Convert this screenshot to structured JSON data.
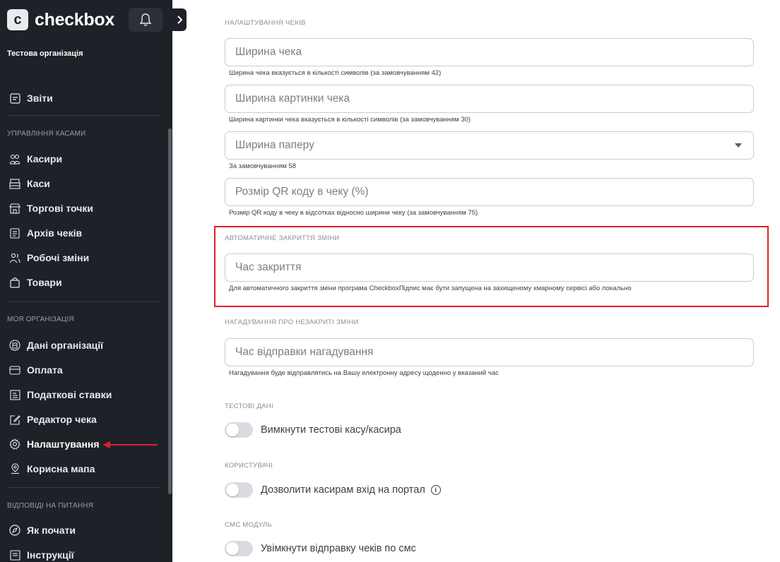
{
  "sidebar": {
    "logo_letter": "c",
    "logo_text": "checkbox",
    "org_name": "Тестова організація",
    "reports": "Звіти",
    "sections": {
      "cash": "УПРАВЛІННЯ КАСАМИ",
      "org": "МОЯ ОРГАНІЗАЦІЯ",
      "faq": "ВІДПОВІДІ НА ПИТАННЯ"
    },
    "items": {
      "cashiers": "Касири",
      "registers": "Каси",
      "points": "Торгові точки",
      "archive": "Архів чеків",
      "shifts": "Робочі зміни",
      "goods": "Товари",
      "org_data": "Дані організації",
      "payment": "Оплата",
      "tax": "Податкові ставки",
      "editor": "Редактор чека",
      "settings": "Налаштування",
      "map": "Корисна мапа",
      "start": "Як почати",
      "instructions": "Інструкції"
    },
    "active_item": "settings"
  },
  "main": {
    "receipt_settings": {
      "title": "НАЛАШТУВАННЯ ЧЕКІВ",
      "width_placeholder": "Ширина чека",
      "width_hint": "Ширина чека вказується в кількості символів (за замовчуванням 42)",
      "image_width_placeholder": "Ширина картинки чека",
      "image_width_hint": "Ширина картинки чека вказується в кількості символів (за замовчуванням 30)",
      "paper_width_placeholder": "Ширина паперу",
      "paper_width_hint": "За замовчуванням 58",
      "qr_placeholder": "Розмір QR коду в чеку (%)",
      "qr_hint": "Розмір QR коду в чеку в відсотках відносно ширини чеку (за замовчуванням 75)"
    },
    "auto_close": {
      "title": "АВТОМАТИЧНЕ ЗАКРИТТЯ ЗМІНИ",
      "time_placeholder": "Час закриття",
      "hint": "Для автоматичного закриття зміни програма CheckboxПідпис має бути запущена на захищеному хмарному сервісі або локально"
    },
    "reminder": {
      "title": "НАГАДУВАННЯ ПРО НЕЗАКРИТІ ЗМІНИ",
      "time_placeholder": "Час відправки нагадування",
      "hint": "Нагадування буде відправлятись на Вашу електронну адресу щоденно у вказаний час"
    },
    "test_data": {
      "title": "ТЕСТОВІ ДАНІ",
      "toggle_label": "Вимкнути тестові касу/касира",
      "enabled": false
    },
    "users": {
      "title": "КОРИСТУВАЧІ",
      "toggle_label": "Дозволити касирам вхід на портал",
      "enabled": false
    },
    "sms": {
      "title": "СМС МОДУЛЬ",
      "toggle_label": "Увімкнути відправку чеків по смс",
      "enabled": false
    }
  },
  "colors": {
    "sidebar_bg": "#1f2128",
    "highlight": "#e0202a"
  }
}
